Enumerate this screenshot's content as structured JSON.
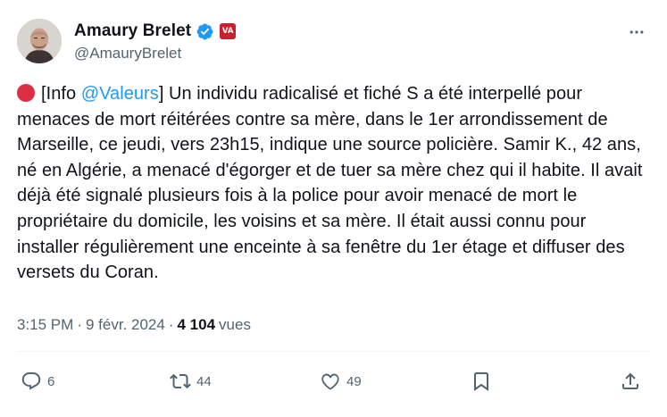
{
  "author": {
    "display_name": "Amaury Brelet",
    "handle": "@AmauryBrelet",
    "affiliation_badge": "VA",
    "verified_color": "#1d9bf0"
  },
  "tweet": {
    "emoji": "red-circle",
    "text_before_mention": "[Info ",
    "mention": "@Valeurs",
    "text_after_mention": "] Un individu radicalisé et fiché S a été interpellé pour menaces de mort réitérées contre sa mère, dans le 1er arrondissement de Marseille, ce jeudi, vers 23h15, indique une source policière. Samir K., 42 ans, né en Algérie, a menacé d'égorger et de tuer sa mère chez qui il habite. Il avait déjà été signalé plusieurs fois à la police pour avoir menacé de mort le propriétaire du domicile, les voisins et sa mère. Il était aussi connu pour installer régulièrement une enceinte à sa fenêtre du 1er étage et diffuser des versets du Coran."
  },
  "meta": {
    "time": "3:15 PM",
    "separator": "·",
    "date": "9 févr. 2024",
    "views_count": "4 104",
    "views_label": "vues"
  },
  "actions": {
    "replies": "6",
    "reposts": "44",
    "likes": "49"
  },
  "colors": {
    "accent": "#1d9bf0",
    "text": "#0f1419",
    "secondary": "#536471",
    "red_circle": "#dd2e44",
    "badge": "#c8202f"
  }
}
